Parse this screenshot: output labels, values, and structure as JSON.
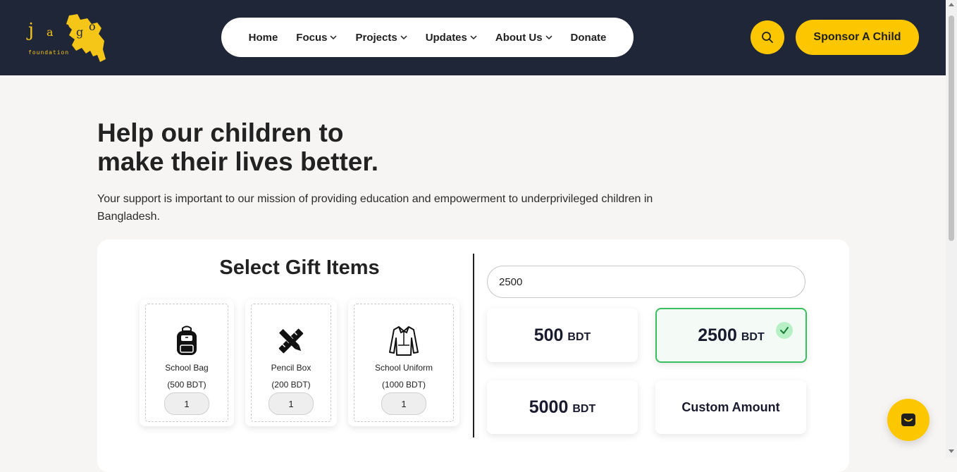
{
  "logo": {
    "letters": [
      "j",
      "a",
      "a",
      "g",
      "o"
    ],
    "subtitle": "foundation",
    "color": "#f5c518"
  },
  "nav": {
    "items": [
      {
        "label": "Home",
        "has_dropdown": false
      },
      {
        "label": "Focus",
        "has_dropdown": true
      },
      {
        "label": "Projects",
        "has_dropdown": true
      },
      {
        "label": "Updates",
        "has_dropdown": true
      },
      {
        "label": "About Us",
        "has_dropdown": true
      },
      {
        "label": "Donate",
        "has_dropdown": false
      }
    ]
  },
  "header": {
    "search_icon": "search-icon",
    "sponsor_label": "Sponsor A Child"
  },
  "hero": {
    "title_line1": "Help our children to",
    "title_line2": "make their lives better.",
    "subtitle": "Your support is important to our mission of providing education and empowerment to underprivileged children in Bangladesh."
  },
  "gifts": {
    "title": "Select Gift Items",
    "items": [
      {
        "name": "School Bag",
        "price": "(500 BDT)",
        "qty": "1",
        "icon": "backpack-icon"
      },
      {
        "name": "Pencil Box",
        "price": "(200 BDT)",
        "qty": "1",
        "icon": "pencil-ruler-icon"
      },
      {
        "name": "School Uniform",
        "price": "(1000 BDT)",
        "qty": "1",
        "icon": "uniform-icon"
      }
    ]
  },
  "donation": {
    "amount_value": "2500",
    "currency": "BDT",
    "options": [
      {
        "amount": "500",
        "selected": false
      },
      {
        "amount": "2500",
        "selected": true
      },
      {
        "amount": "5000",
        "selected": false
      }
    ],
    "custom_label": "Custom Amount"
  },
  "colors": {
    "header_bg": "#1f2637",
    "accent": "#fdc700",
    "selected_border": "#3bbf5e",
    "page_bg": "#f7f5f3"
  }
}
